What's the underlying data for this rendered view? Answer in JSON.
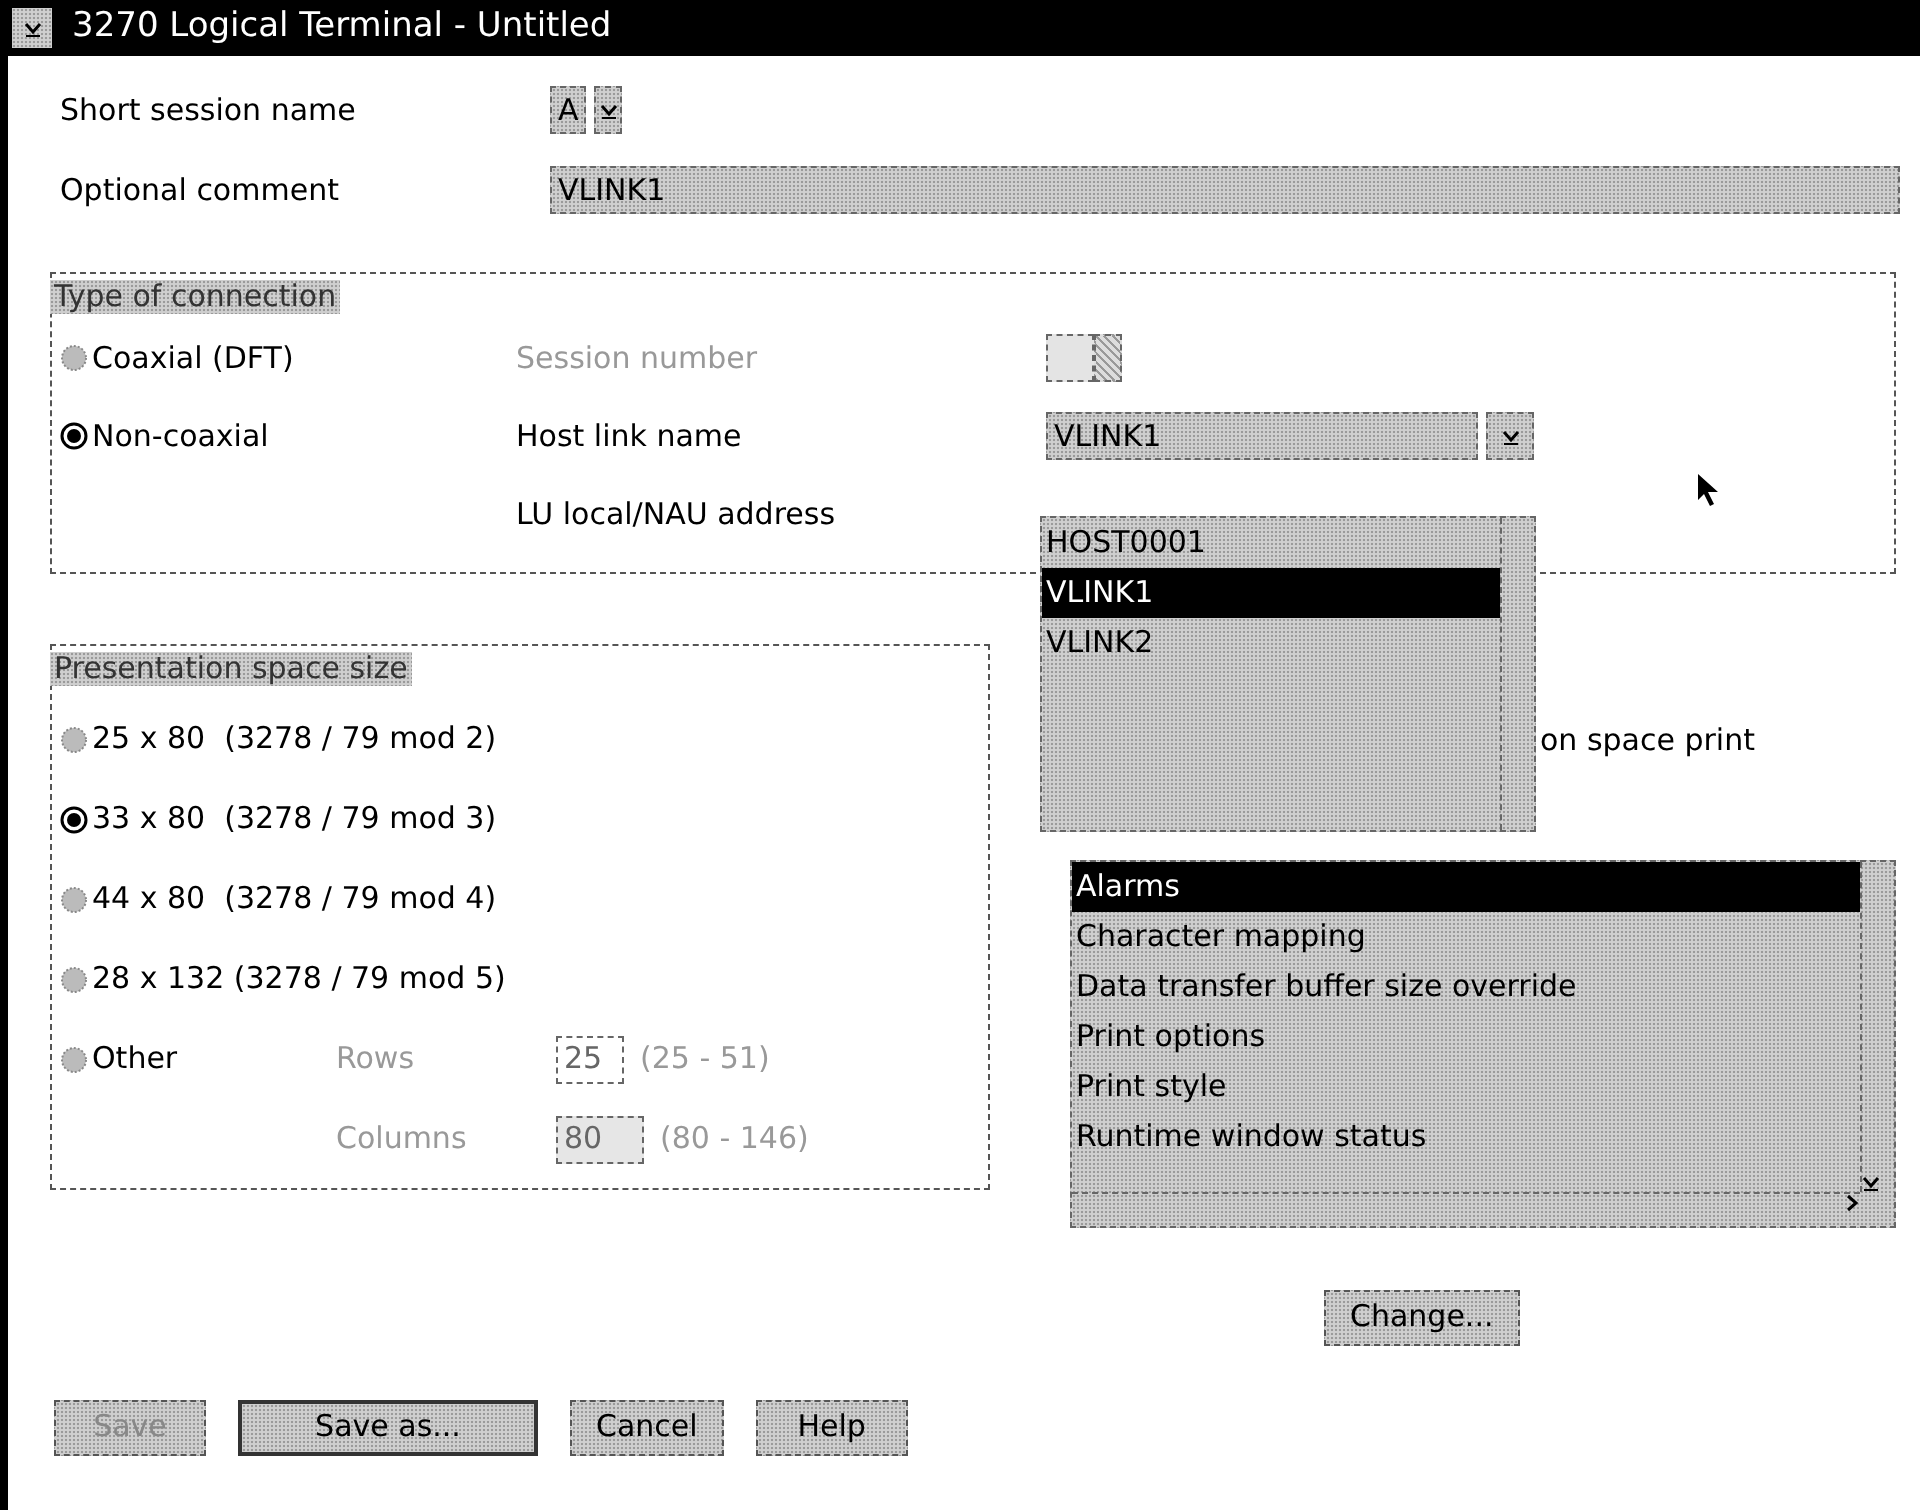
{
  "window": {
    "title": "3270 Logical Terminal - Untitled"
  },
  "short_session_name": {
    "label": "Short session name",
    "value": "A"
  },
  "optional_comment": {
    "label": "Optional comment",
    "value": "VLINK1"
  },
  "connection": {
    "legend": "Type of connection",
    "options": [
      {
        "label": "Coaxial (DFT)",
        "selected": false
      },
      {
        "label": "Non-coaxial",
        "selected": true
      }
    ],
    "session_number": {
      "label": "Session number",
      "disabled": true
    },
    "host_link_name": {
      "label": "Host link name",
      "value": "VLINK1",
      "items": [
        {
          "label": "HOST0001",
          "selected": false
        },
        {
          "label": "VLINK1",
          "selected": true
        },
        {
          "label": "VLINK2",
          "selected": false
        }
      ]
    },
    "lu_address": {
      "label": "LU local/NAU address"
    }
  },
  "presentation_space": {
    "legend": "Presentation space size",
    "options": [
      {
        "label": "25 x 80  (3278 / 79 mod 2)",
        "selected": false
      },
      {
        "label": "33 x 80  (3278 / 79 mod 3)",
        "selected": true
      },
      {
        "label": "44 x 80  (3278 / 79 mod 4)",
        "selected": false
      },
      {
        "label": "28 x 132 (3278 / 79 mod 5)",
        "selected": false
      },
      {
        "label": "Other",
        "selected": false
      }
    ],
    "rows": {
      "label": "Rows",
      "value": "25",
      "range": "(25 - 51)",
      "disabled": true
    },
    "columns": {
      "label": "Columns",
      "value": "80",
      "range": "(80 - 146)",
      "disabled": true
    }
  },
  "print_fragment": "on space print",
  "options_list": {
    "items": [
      {
        "label": "Alarms",
        "selected": true
      },
      {
        "label": "Character mapping",
        "selected": false
      },
      {
        "label": "Data transfer buffer size override",
        "selected": false
      },
      {
        "label": "Print options",
        "selected": false
      },
      {
        "label": "Print style",
        "selected": false
      },
      {
        "label": "Runtime window status",
        "selected": false
      }
    ]
  },
  "change_button": {
    "label": "Change..."
  },
  "buttons": [
    {
      "label": "Save",
      "disabled": true
    },
    {
      "label": "Save as...",
      "disabled": false
    },
    {
      "label": "Cancel",
      "disabled": false
    },
    {
      "label": "Help",
      "disabled": false
    }
  ]
}
